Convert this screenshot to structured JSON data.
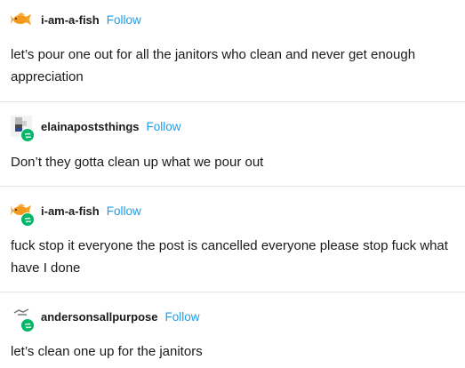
{
  "posts": [
    {
      "username": "i-am-a-fish",
      "follow_label": "Follow",
      "avatar": "goldfish-icon",
      "reblog": false,
      "text": "let’s pour one out for all the janitors who clean and never get enough appreciation"
    },
    {
      "username": "elainapoststhings",
      "follow_label": "Follow",
      "avatar": "pixel-avatar",
      "reblog": true,
      "text": "Don’t they gotta clean up what we pour out"
    },
    {
      "username": "i-am-a-fish",
      "follow_label": "Follow",
      "avatar": "goldfish-icon",
      "reblog": true,
      "text": "fuck stop it everyone the post is cancelled everyone please stop fuck what have I done"
    },
    {
      "username": "andersonsallpurpose",
      "follow_label": "Follow",
      "avatar": "cartoon-avatar",
      "reblog": true,
      "text": "let’s clean one up for the janitors"
    }
  ],
  "colors": {
    "follow": "#1f9ee8",
    "reblog_badge": "#00b868",
    "divider": "#e4e4e4"
  }
}
